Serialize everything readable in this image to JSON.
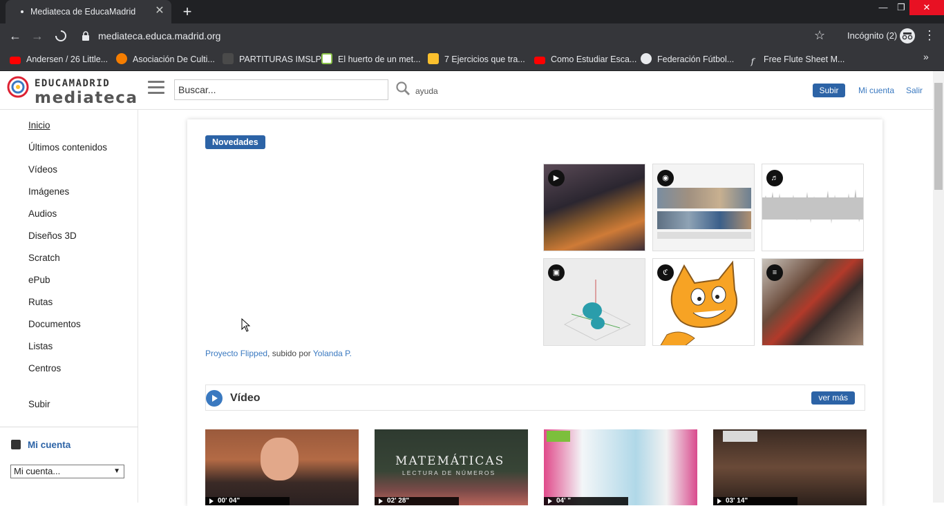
{
  "browser": {
    "tab_title": "Mediateca de EducaMadrid",
    "tab_close": "✕",
    "new_tab": "+",
    "url": "mediateca.educa.madrid.org",
    "incognito_label": "Incógnito (2)",
    "window_controls": [
      "—",
      "❐",
      "✕"
    ],
    "bookmarks": [
      {
        "label": "Andersen / 26 Little...",
        "icon": "youtube-icon",
        "color": "#ff0000"
      },
      {
        "label": "Asociación De Culti...",
        "icon": "blogger-icon",
        "color": "#f57d00"
      },
      {
        "label": "PARTITURAS IMSLP",
        "icon": "imslp-icon",
        "color": "#444444"
      },
      {
        "label": "El huerto de un met...",
        "icon": "image-icon",
        "color": "#8bc34a"
      },
      {
        "label": "7 Ejercicios que tra...",
        "icon": "ge-icon",
        "color": "#fbc02d"
      },
      {
        "label": "Como Estudiar Esca...",
        "icon": "youtube-icon",
        "color": "#ff0000"
      },
      {
        "label": "Federación Fútbol...",
        "icon": "globe-icon",
        "color": "#e8eaed"
      },
      {
        "label": "Free Flute Sheet M...",
        "icon": "script-f-icon",
        "color": "#35363a"
      }
    ],
    "bookmarks_more": "»"
  },
  "header": {
    "logo_top": "EDUCAMADRID",
    "logo_bottom": "mediateca",
    "search_placeholder": "Buscar...",
    "help": "ayuda",
    "upload": "Subir",
    "my_account": "Mi cuenta",
    "logout": "Salir",
    "brand_color": "#2c63a6"
  },
  "sidebar": {
    "items": [
      "Inicio",
      "Últimos contenidos",
      "Vídeos",
      "Imágenes",
      "Audios",
      "Diseños 3D",
      "Scratch",
      "ePub",
      "Rutas",
      "Documentos",
      "Listas",
      "Centros"
    ],
    "upload": "Subir",
    "account_title": "Mi cuenta",
    "account_select": "Mi cuenta..."
  },
  "main": {
    "novedades": "Novedades",
    "thumbnails": [
      {
        "type": "video",
        "icon": "play-icon"
      },
      {
        "type": "image",
        "icon": "camera-icon"
      },
      {
        "type": "audio",
        "icon": "audio-icon"
      },
      {
        "type": "3d",
        "icon": "cube-icon"
      },
      {
        "type": "scratch",
        "icon": "scratch-icon"
      },
      {
        "type": "document",
        "icon": "list-icon"
      }
    ],
    "credit_link": "Proyecto Flipped",
    "credit_mid": ", subido por ",
    "credit_user": "Yolanda P.",
    "video_section_title": "Vídeo",
    "ver_mas": "ver más",
    "videos": [
      {
        "duration": "00' 04\""
      },
      {
        "duration": "02' 28\"",
        "overlay_title": "MATEMÁTICAS",
        "overlay_sub": "LECTURA DE NÚMEROS"
      },
      {
        "duration": "04' \""
      },
      {
        "duration": "03' 14\""
      }
    ]
  }
}
